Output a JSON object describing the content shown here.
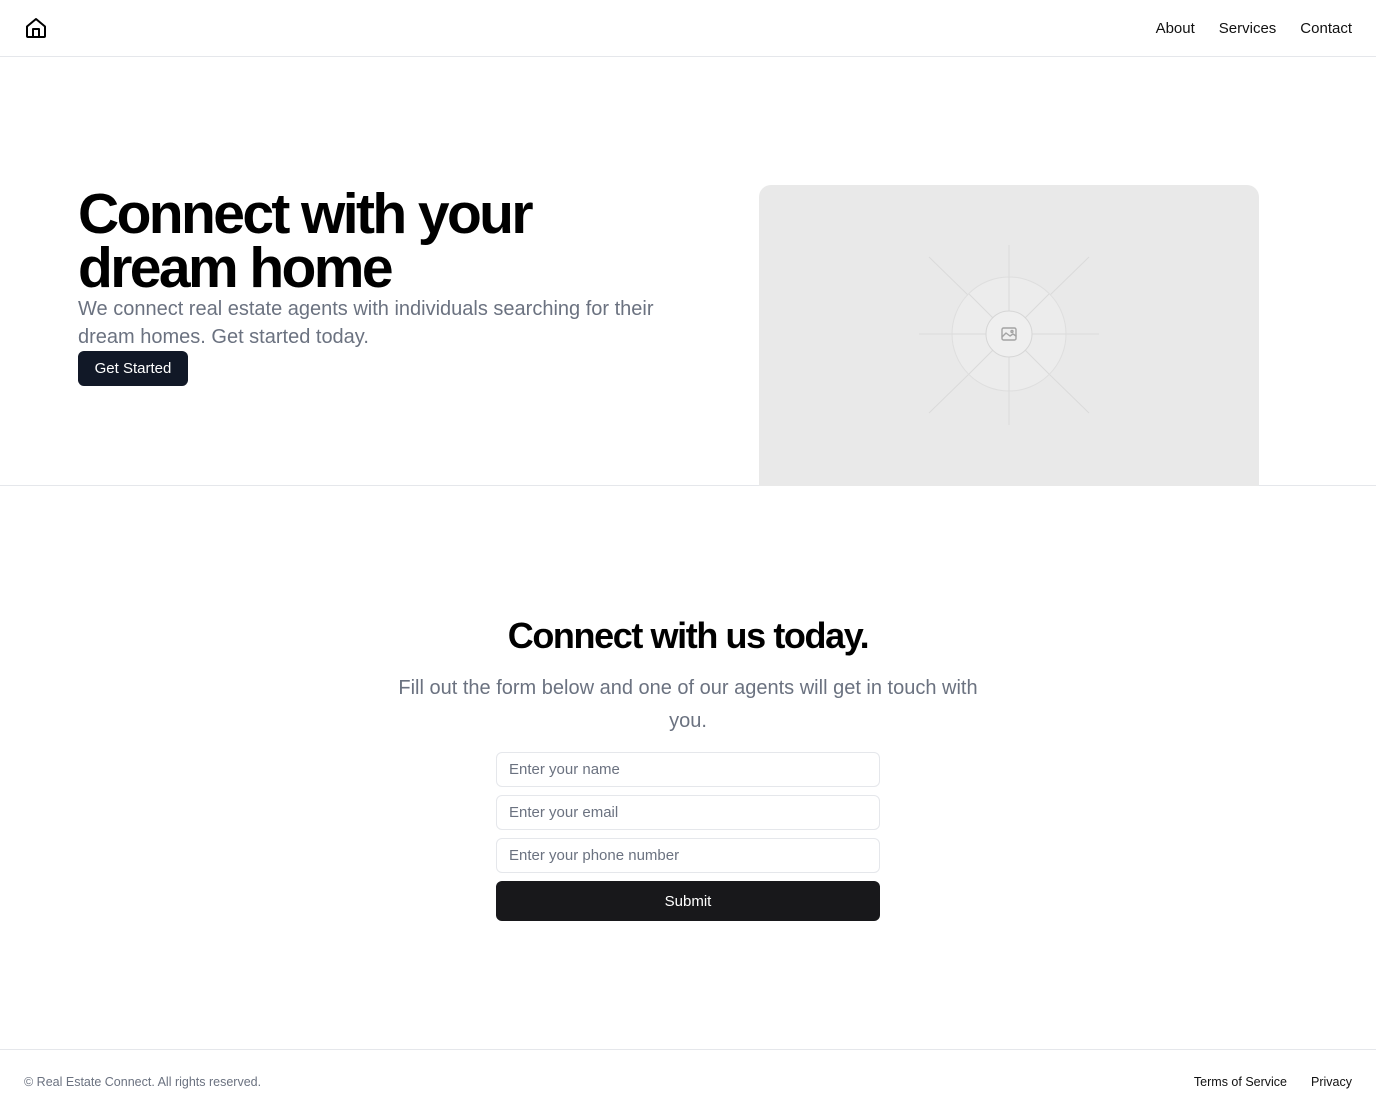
{
  "header": {
    "logo_icon": "home-icon",
    "nav": [
      {
        "label": "About"
      },
      {
        "label": "Services"
      },
      {
        "label": "Contact"
      }
    ]
  },
  "hero": {
    "title": "Connect with your dream home",
    "subtitle": "We connect real estate agents with individuals searching for their dream homes. Get started today.",
    "cta_label": "Get Started",
    "image_icon": "image-placeholder-icon"
  },
  "contact": {
    "title": "Connect with us today.",
    "subtitle": "Fill out the form below and one of our agents will get in touch with you.",
    "name_placeholder": "Enter your name",
    "email_placeholder": "Enter your email",
    "phone_placeholder": "Enter your phone number",
    "submit_label": "Submit"
  },
  "footer": {
    "copyright": "© Real Estate Connect. All rights reserved.",
    "links": [
      {
        "label": "Terms of Service"
      },
      {
        "label": "Privacy"
      }
    ]
  },
  "colors": {
    "primary_button": "#111827",
    "submit_button": "#18181b",
    "muted_text": "#6b7280",
    "border": "#e5e7eb",
    "placeholder_bg": "#e9e9e9"
  }
}
